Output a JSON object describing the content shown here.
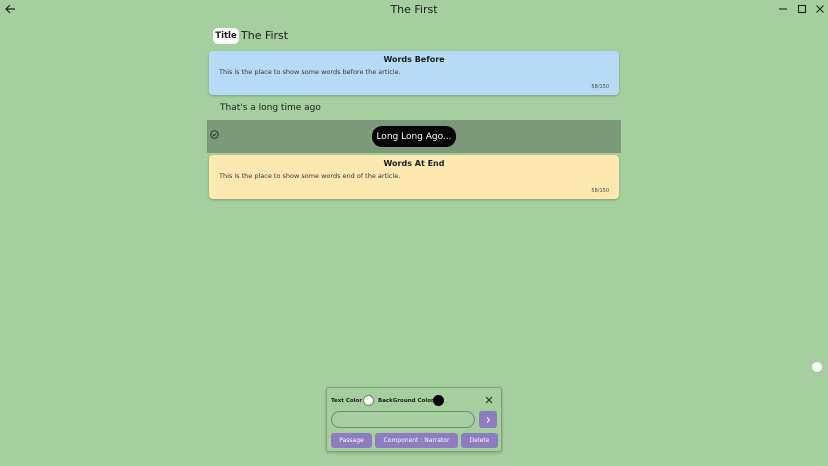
{
  "window": {
    "title": "The First"
  },
  "document": {
    "title_chip": "Title",
    "title": "The First",
    "narration": "That's a long time ago"
  },
  "cards": {
    "before": {
      "heading": "Words Before",
      "body": "This is the place to show some words before the article.",
      "counter": "58/150"
    },
    "end": {
      "heading": "Words At End",
      "body": "This is the place to show some words end of the article.",
      "counter": "58/150"
    }
  },
  "selected_block": {
    "text": "Long Long Ago..."
  },
  "panel": {
    "text_color_label": "Text Color",
    "bg_color_label": "BackGround Color",
    "input_value": "",
    "input_placeholder": "",
    "buttons": {
      "passage": "Passage",
      "narrator": "Component : Narrator",
      "delete": "Delete"
    }
  },
  "colors": {
    "background": "#a5cf9f",
    "card_before": "#b7dbf6",
    "card_end": "#fde9b0",
    "selected_block": "#7c9a79",
    "accent": "#8e7bc0",
    "text_color_swatch": "#ffffff",
    "bg_color_swatch": "#000000"
  },
  "icons": [
    "arrow-left-icon",
    "minimize-icon",
    "maximize-icon",
    "close-icon",
    "check-circle-icon",
    "chevron-right-icon"
  ]
}
